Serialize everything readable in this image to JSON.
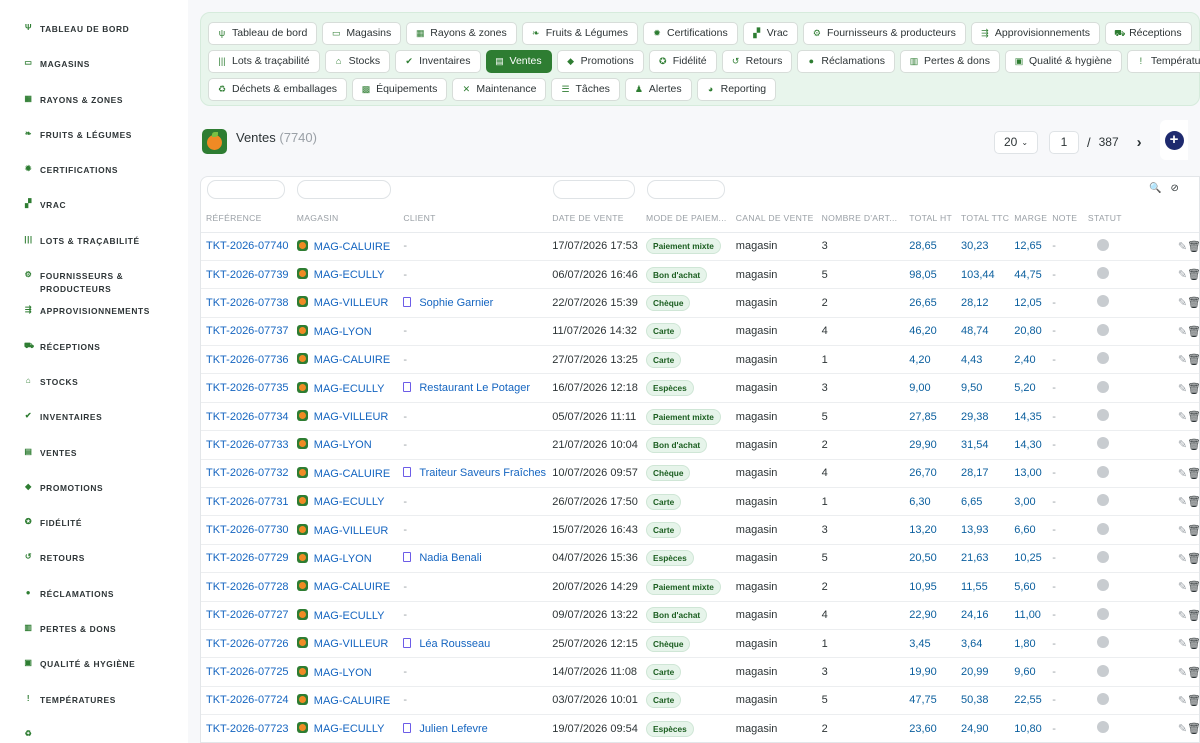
{
  "sidebar": {
    "items": [
      {
        "label": "Tableau de bord",
        "icon": "sprout-icon"
      },
      {
        "label": "Magasins",
        "icon": "store-icon"
      },
      {
        "label": "Rayons & zones",
        "icon": "grid-icon"
      },
      {
        "label": "Fruits & Légumes",
        "icon": "leaf-icon"
      },
      {
        "label": "Certifications",
        "icon": "certificate-icon"
      },
      {
        "label": "Vrac",
        "icon": "boxes-icon"
      },
      {
        "label": "Lots & traçabilité",
        "icon": "barcode-icon"
      },
      {
        "label": "Fournisseurs & producteurs",
        "icon": "tractor-icon"
      },
      {
        "label": "Approvisionnements",
        "icon": "truck-loading-icon"
      },
      {
        "label": "Réceptions",
        "icon": "truck-icon"
      },
      {
        "label": "Stocks",
        "icon": "warehouse-icon"
      },
      {
        "label": "Inventaires",
        "icon": "clipboard-check-icon"
      },
      {
        "label": "Ventes",
        "icon": "cash-register-icon"
      },
      {
        "label": "Promotions",
        "icon": "tag-icon"
      },
      {
        "label": "Fidélité",
        "icon": "award-icon"
      },
      {
        "label": "Retours",
        "icon": "undo-icon"
      },
      {
        "label": "Réclamations",
        "icon": "comment-icon"
      },
      {
        "label": "Pertes & dons",
        "icon": "trash-icon"
      },
      {
        "label": "Qualité & hygiène",
        "icon": "clipboard-icon"
      },
      {
        "label": "Températures",
        "icon": "thermometer-icon"
      },
      {
        "label": "",
        "icon": "recycle-icon"
      }
    ]
  },
  "nav": {
    "rows": [
      [
        {
          "label": "Tableau de bord",
          "icon": "sprout-icon"
        },
        {
          "label": "Magasins",
          "icon": "store-icon"
        },
        {
          "label": "Rayons & zones",
          "icon": "grid-icon"
        },
        {
          "label": "Fruits & Légumes",
          "icon": "leaf-icon"
        },
        {
          "label": "Certifications",
          "icon": "certificate-icon"
        },
        {
          "label": "Vrac",
          "icon": "boxes-icon"
        },
        {
          "label": "Fournisseurs & producteurs",
          "icon": "tractor-icon"
        },
        {
          "label": "Approvisionnements",
          "icon": "truck-loading-icon"
        },
        {
          "label": "Réceptions",
          "icon": "truck-icon"
        }
      ],
      [
        {
          "label": "Lots & traçabilité",
          "icon": "barcode-icon"
        },
        {
          "label": "Stocks",
          "icon": "warehouse-icon"
        },
        {
          "label": "Inventaires",
          "icon": "clipboard-check-icon"
        },
        {
          "label": "Ventes",
          "icon": "cash-register-icon",
          "active": true
        },
        {
          "label": "Promotions",
          "icon": "tag-icon"
        },
        {
          "label": "Fidélité",
          "icon": "award-icon"
        },
        {
          "label": "Retours",
          "icon": "undo-icon"
        },
        {
          "label": "Réclamations",
          "icon": "comment-icon"
        },
        {
          "label": "Pertes & dons",
          "icon": "trash-icon"
        },
        {
          "label": "Qualité & hygiène",
          "icon": "clipboard-icon"
        },
        {
          "label": "Températures",
          "icon": "thermometer-icon"
        }
      ],
      [
        {
          "label": "Déchets & emballages",
          "icon": "recycle-icon"
        },
        {
          "label": "Équipements",
          "icon": "cart-icon"
        },
        {
          "label": "Maintenance",
          "icon": "tools-icon"
        },
        {
          "label": "Tâches",
          "icon": "list-icon"
        },
        {
          "label": "Alertes",
          "icon": "bell-icon"
        },
        {
          "label": "Reporting",
          "icon": "pie-chart-icon"
        }
      ]
    ]
  },
  "page": {
    "title": "Ventes",
    "count": "(7740)"
  },
  "pager": {
    "per_page": "20",
    "current": "1",
    "separator": "/",
    "total": "387",
    "next": "›"
  },
  "add_button": "+",
  "table": {
    "columns": [
      "Référence",
      "Magasin",
      "Client",
      "Date de vente",
      "Mode de paiem...",
      "Canal de vente",
      "Nombre d'art...",
      "Total HT",
      "Total TTC",
      "Marge",
      "Note",
      "Statut"
    ],
    "rows": [
      [
        "TKT-2026-07740",
        "MAG-CALUIRE",
        "-",
        "17/07/2026 17:53",
        "Paiement mixte",
        "magasin",
        "3",
        "28,65",
        "30,23",
        "12,65",
        "-"
      ],
      [
        "TKT-2026-07739",
        "MAG-ECULLY",
        "-",
        "06/07/2026 16:46",
        "Bon d'achat",
        "magasin",
        "5",
        "98,05",
        "103,44",
        "44,75",
        "-"
      ],
      [
        "TKT-2026-07738",
        "MAG-VILLEUR",
        "Sophie Garnier",
        "22/07/2026 15:39",
        "Chèque",
        "magasin",
        "2",
        "26,65",
        "28,12",
        "12,05",
        "-"
      ],
      [
        "TKT-2026-07737",
        "MAG-LYON",
        "-",
        "11/07/2026 14:32",
        "Carte",
        "magasin",
        "4",
        "46,20",
        "48,74",
        "20,80",
        "-"
      ],
      [
        "TKT-2026-07736",
        "MAG-CALUIRE",
        "-",
        "27/07/2026 13:25",
        "Carte",
        "magasin",
        "1",
        "4,20",
        "4,43",
        "2,40",
        "-"
      ],
      [
        "TKT-2026-07735",
        "MAG-ECULLY",
        "Restaurant Le Potager",
        "16/07/2026 12:18",
        "Espèces",
        "magasin",
        "3",
        "9,00",
        "9,50",
        "5,20",
        "-"
      ],
      [
        "TKT-2026-07734",
        "MAG-VILLEUR",
        "-",
        "05/07/2026 11:11",
        "Paiement mixte",
        "magasin",
        "5",
        "27,85",
        "29,38",
        "14,35",
        "-"
      ],
      [
        "TKT-2026-07733",
        "MAG-LYON",
        "-",
        "21/07/2026 10:04",
        "Bon d'achat",
        "magasin",
        "2",
        "29,90",
        "31,54",
        "14,30",
        "-"
      ],
      [
        "TKT-2026-07732",
        "MAG-CALUIRE",
        "Traiteur Saveurs Fraîches",
        "10/07/2026 09:57",
        "Chèque",
        "magasin",
        "4",
        "26,70",
        "28,17",
        "13,00",
        "-"
      ],
      [
        "TKT-2026-07731",
        "MAG-ECULLY",
        "-",
        "26/07/2026 17:50",
        "Carte",
        "magasin",
        "1",
        "6,30",
        "6,65",
        "3,00",
        "-"
      ],
      [
        "TKT-2026-07730",
        "MAG-VILLEUR",
        "-",
        "15/07/2026 16:43",
        "Carte",
        "magasin",
        "3",
        "13,20",
        "13,93",
        "6,60",
        "-"
      ],
      [
        "TKT-2026-07729",
        "MAG-LYON",
        "Nadia Benali",
        "04/07/2026 15:36",
        "Espèces",
        "magasin",
        "5",
        "20,50",
        "21,63",
        "10,25",
        "-"
      ],
      [
        "TKT-2026-07728",
        "MAG-CALUIRE",
        "-",
        "20/07/2026 14:29",
        "Paiement mixte",
        "magasin",
        "2",
        "10,95",
        "11,55",
        "5,60",
        "-"
      ],
      [
        "TKT-2026-07727",
        "MAG-ECULLY",
        "-",
        "09/07/2026 13:22",
        "Bon d'achat",
        "magasin",
        "4",
        "22,90",
        "24,16",
        "11,00",
        "-"
      ],
      [
        "TKT-2026-07726",
        "MAG-VILLEUR",
        "Léa Rousseau",
        "25/07/2026 12:15",
        "Chèque",
        "magasin",
        "1",
        "3,45",
        "3,64",
        "1,80",
        "-"
      ],
      [
        "TKT-2026-07725",
        "MAG-LYON",
        "-",
        "14/07/2026 11:08",
        "Carte",
        "magasin",
        "3",
        "19,90",
        "20,99",
        "9,60",
        "-"
      ],
      [
        "TKT-2026-07724",
        "MAG-CALUIRE",
        "-",
        "03/07/2026 10:01",
        "Carte",
        "magasin",
        "5",
        "47,75",
        "50,38",
        "22,55",
        "-"
      ],
      [
        "TKT-2026-07723",
        "MAG-ECULLY",
        "Julien Lefevre",
        "19/07/2026 09:54",
        "Espèces",
        "magasin",
        "2",
        "23,60",
        "24,90",
        "10,80",
        "-"
      ]
    ]
  },
  "colors": {
    "accent": "#2e7d32",
    "link": "#1565c0",
    "number": "#0b5f9e",
    "badge_bg": "#e6f4ea",
    "nav_bg": "#e8f5ec"
  }
}
